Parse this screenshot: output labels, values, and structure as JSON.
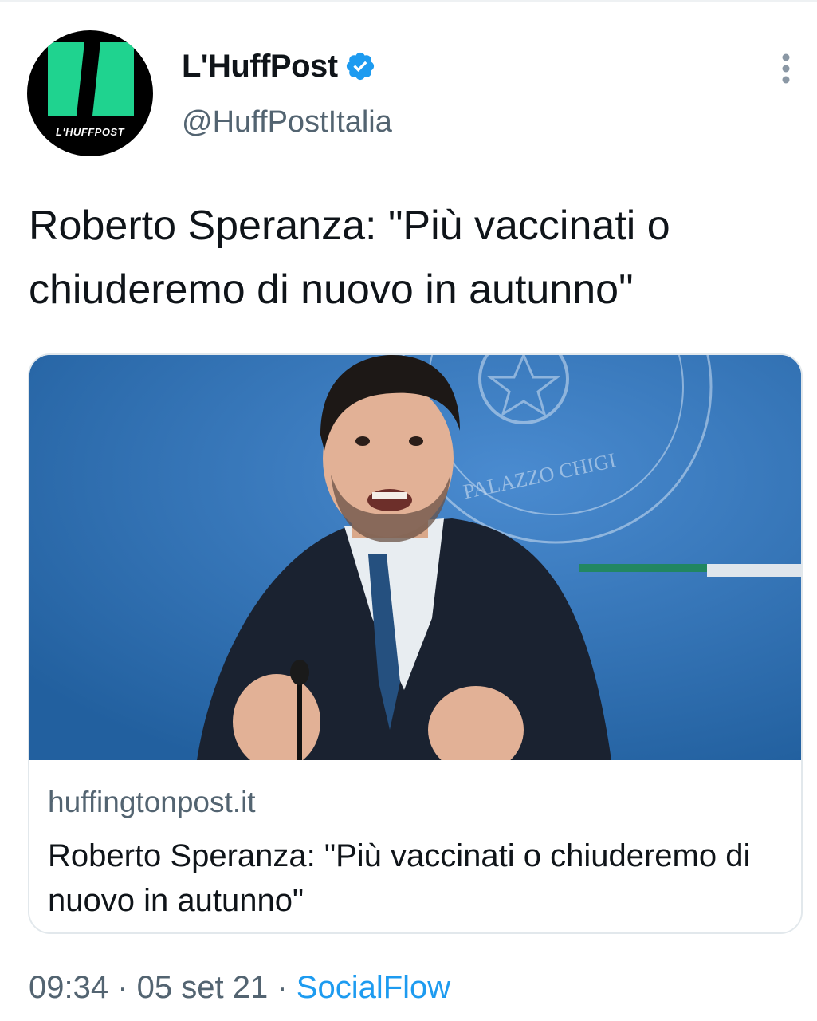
{
  "author": {
    "display_name": "L'HuffPost",
    "handle": "@HuffPostItalia",
    "verified": true,
    "avatar_wordmark": "L'HUFFPOST",
    "avatar_colors": {
      "background": "#000000",
      "accent": "#1fd38f"
    }
  },
  "tweet": {
    "text": "Roberto Speranza: \"Più vaccinati o chiuderemo di nuovo in autunno\""
  },
  "card": {
    "domain": "huffingtonpost.it",
    "title": "Roberto Speranza: \"Più vaccinati o chiuderemo di nuovo in autunno\"",
    "image_description_icon": "press-photo",
    "seal_text": "PALAZZO CHIGI"
  },
  "meta": {
    "time": "09:34",
    "separator": " · ",
    "date": "05 set 21",
    "source": "SocialFlow"
  },
  "icons": {
    "verified": "verified-badge-icon",
    "more": "more-vertical-icon"
  },
  "colors": {
    "link_blue": "#1d9bf0",
    "secondary_text": "#536471",
    "primary_text": "#0f1419",
    "card_border": "#e2e8ec"
  }
}
